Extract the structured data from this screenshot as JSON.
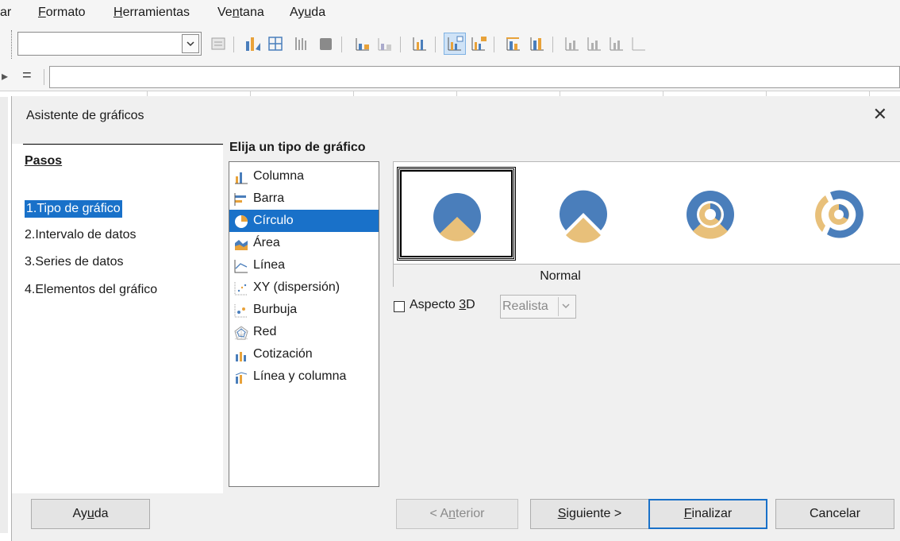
{
  "menubar": {
    "items": [
      {
        "text": "ar"
      },
      {
        "pre": "",
        "mn": "F",
        "post": "ormato"
      },
      {
        "pre": "",
        "mn": "H",
        "post": "erramientas"
      },
      {
        "pre": "Ve",
        "mn": "n",
        "post": "tana"
      },
      {
        "pre": "Ay",
        "mn": "u",
        "post": "da"
      }
    ]
  },
  "toolbar": {
    "combo_value": "",
    "icons": [
      "chart-dialog-icon",
      "chart-type-icon",
      "data-table-icon",
      "row-icon",
      "wall-icon",
      "format-icon",
      "legend-icon",
      "axis-icon",
      "data-series-icon",
      "data-in-rows-icon",
      "data-in-columns-icon",
      "title-icon",
      "grid-icon",
      "scale-text-icon",
      "autolayout-icon",
      "x-axis-icon",
      "y-axis-icon",
      "z-axis-icon",
      "lines-icon"
    ]
  },
  "formula": {
    "eq": "=",
    "value": ""
  },
  "dialog": {
    "title": "Asistente de gráficos",
    "close_glyph": "✕",
    "steps_heading": "Pasos",
    "steps": [
      {
        "label": "1.Tipo de gráfico",
        "active": true
      },
      {
        "label": "2.Intervalo de datos",
        "active": false
      },
      {
        "label": "3.Series de datos",
        "active": false
      },
      {
        "label": "4.Elementos del gráfico",
        "active": false
      }
    ],
    "chooser_label": "Elija un tipo de gráfico",
    "chart_types": [
      {
        "label": "Columna",
        "icon": "column-chart-icon"
      },
      {
        "label": "Barra",
        "icon": "bar-chart-icon"
      },
      {
        "label": "Círculo",
        "icon": "pie-chart-icon",
        "selected": true
      },
      {
        "label": "Área",
        "icon": "area-chart-icon"
      },
      {
        "label": "Línea",
        "icon": "line-chart-icon"
      },
      {
        "label": "XY (dispersión)",
        "icon": "scatter-chart-icon"
      },
      {
        "label": "Burbuja",
        "icon": "bubble-chart-icon"
      },
      {
        "label": "Red",
        "icon": "net-chart-icon"
      },
      {
        "label": "Cotización",
        "icon": "stock-chart-icon"
      },
      {
        "label": "Línea y columna",
        "icon": "column-line-chart-icon"
      }
    ],
    "variants": [
      {
        "name": "normal-pie",
        "selected": true
      },
      {
        "name": "exploded-pie"
      },
      {
        "name": "donut"
      },
      {
        "name": "exploded-donut"
      }
    ],
    "variant_caption": "Normal",
    "aspect3d": {
      "pre": "Aspecto ",
      "mn": "3",
      "post": "D",
      "checked": false
    },
    "shape_value": "Realista",
    "buttons": {
      "help": {
        "pre": "Ay",
        "mn": "u",
        "post": "da"
      },
      "back": {
        "pre": "< A",
        "mn": "n",
        "post": "terior"
      },
      "next": {
        "pre": "",
        "mn": "S",
        "post": "iguiente >"
      },
      "finish": {
        "pre": "",
        "mn": "F",
        "post": "inalizar"
      },
      "cancel": {
        "label": "Cancelar"
      }
    }
  },
  "colors": {
    "accent": "#1971c9",
    "pie_blue": "#4a7ebb",
    "pie_tan": "#e8c07a"
  }
}
